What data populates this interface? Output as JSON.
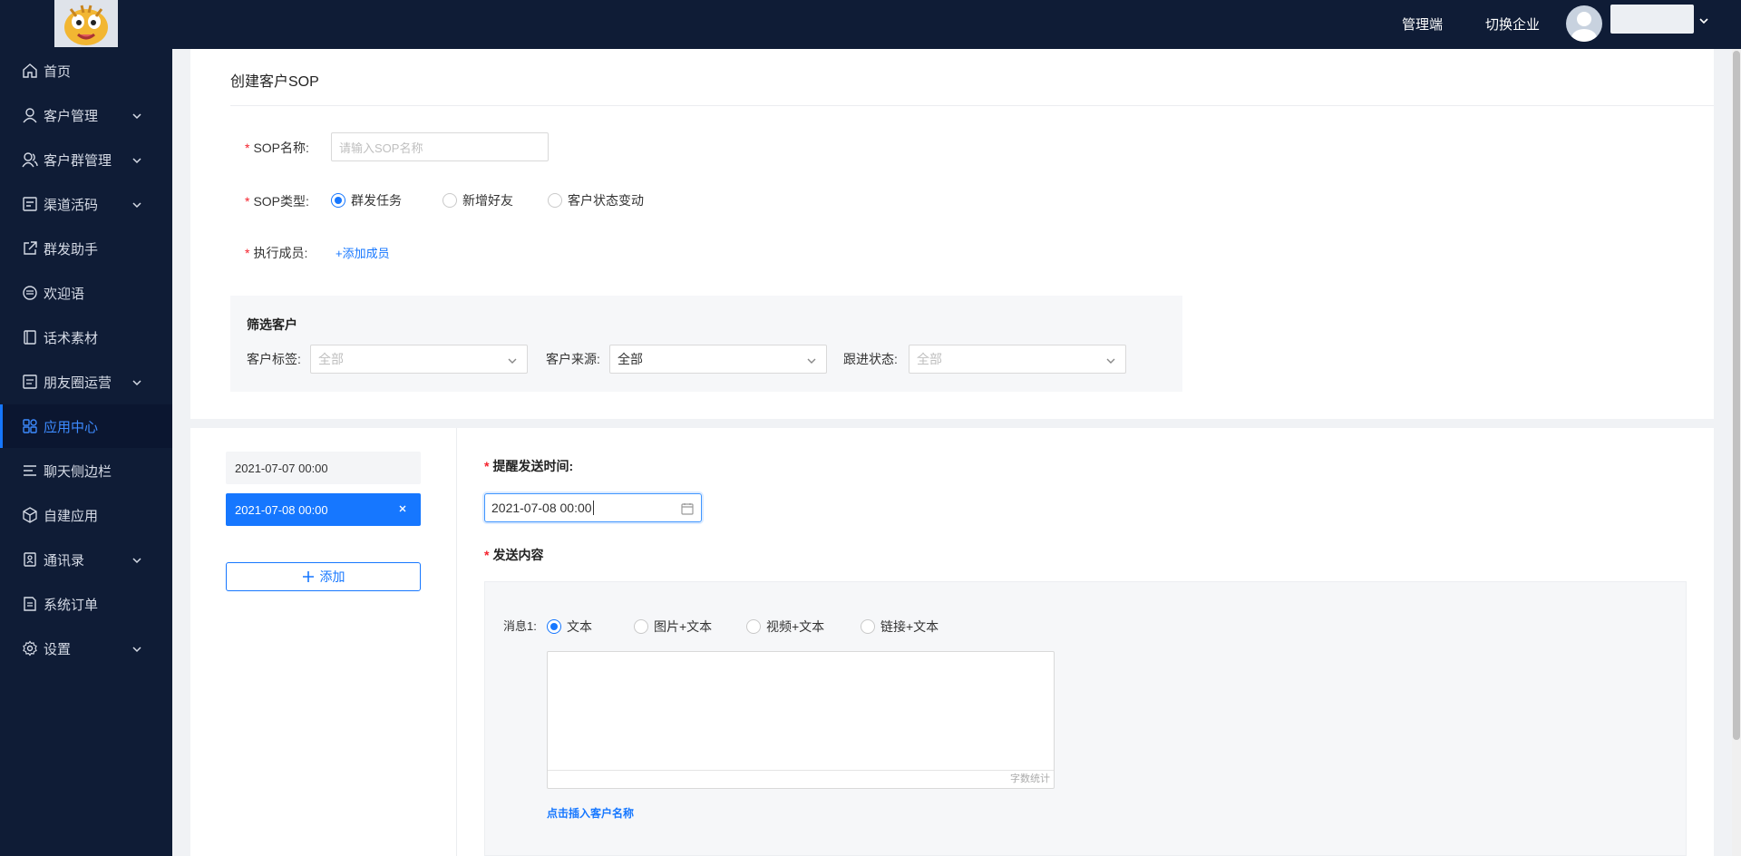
{
  "header": {
    "admin_link": "管理端",
    "switch_company": "切换企业",
    "username": ""
  },
  "sidebar": {
    "items": [
      {
        "label": "首页",
        "icon": "home-icon",
        "expandable": false
      },
      {
        "label": "客户管理",
        "icon": "user-icon",
        "expandable": true
      },
      {
        "label": "客户群管理",
        "icon": "users-icon",
        "expandable": true
      },
      {
        "label": "渠道活码",
        "icon": "qrcode-icon",
        "expandable": true
      },
      {
        "label": "群发助手",
        "icon": "share-icon",
        "expandable": false
      },
      {
        "label": "欢迎语",
        "icon": "message-icon",
        "expandable": false
      },
      {
        "label": "话术素材",
        "icon": "book-icon",
        "expandable": false
      },
      {
        "label": "朋友圈运营",
        "icon": "moments-icon",
        "expandable": true
      },
      {
        "label": "应用中心",
        "icon": "apps-icon",
        "expandable": false,
        "active": true
      },
      {
        "label": "聊天侧边栏",
        "icon": "menu-icon",
        "expandable": false
      },
      {
        "label": "自建应用",
        "icon": "cube-icon",
        "expandable": false
      },
      {
        "label": "通讯录",
        "icon": "contacts-icon",
        "expandable": true
      },
      {
        "label": "系统订单",
        "icon": "order-icon",
        "expandable": false
      },
      {
        "label": "设置",
        "icon": "gear-icon",
        "expandable": true
      }
    ],
    "accent": "#1677ff"
  },
  "form": {
    "title": "创建客户SOP",
    "sop_name_label": "SOP名称:",
    "sop_name_placeholder": "请输入SOP名称",
    "sop_type_label": "SOP类型:",
    "sop_types": [
      "群发任务",
      "新增好友",
      "客户状态变动"
    ],
    "sop_type_selected": "群发任务",
    "members_label": "执行成员:",
    "add_member": "+添加成员",
    "filter": {
      "title": "筛选客户",
      "tag_label": "客户标签:",
      "tag_value": "全部",
      "source_label": "客户来源:",
      "source_value": "全部",
      "status_label": "跟进状态:",
      "status_value": "全部"
    }
  },
  "schedule": {
    "dates": [
      "2021-07-07 00:00",
      "2021-07-08 00:00"
    ],
    "selected_date": "2021-07-08 00:00",
    "add_label": "添加",
    "remind_label": "提醒发送时间:",
    "remind_value": "2021-07-08 00:00",
    "content_label": "发送内容",
    "message_label": "消息1:",
    "message_types": [
      "文本",
      "图片+文本",
      "视频+文本",
      "链接+文本"
    ],
    "message_type_selected": "文本",
    "counter_label": "字数统计",
    "insert_link": "点击插入客户名称"
  }
}
